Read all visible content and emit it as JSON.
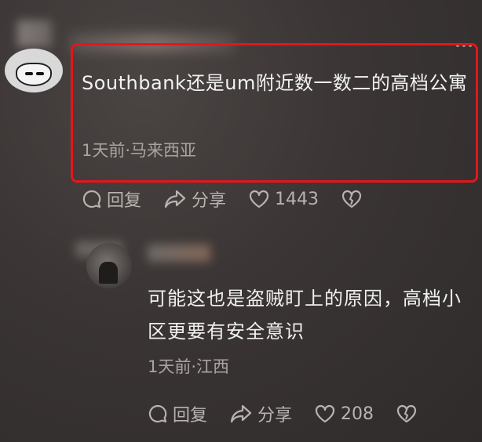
{
  "comment": {
    "text": "Southbank还是um附近数一数二的高档公寓",
    "meta": "1天前·马来西亚",
    "actions": {
      "reply_label": "回复",
      "share_label": "分享",
      "like_count": "1443"
    }
  },
  "reply": {
    "text": "可能这也是盗贼盯上的原因，高档小区更要有安全意识",
    "meta": "1天前·江西",
    "actions": {
      "reply_label": "回复",
      "share_label": "分享",
      "like_count": "208"
    }
  },
  "colors": {
    "highlight_border": "#e8141b",
    "background": "#3a3534",
    "text_primary": "#f2f2f2",
    "text_secondary": "#a9a4a2"
  },
  "icons": [
    "more-icon",
    "comment-icon",
    "share-icon",
    "heart-icon",
    "broken-heart-icon"
  ]
}
